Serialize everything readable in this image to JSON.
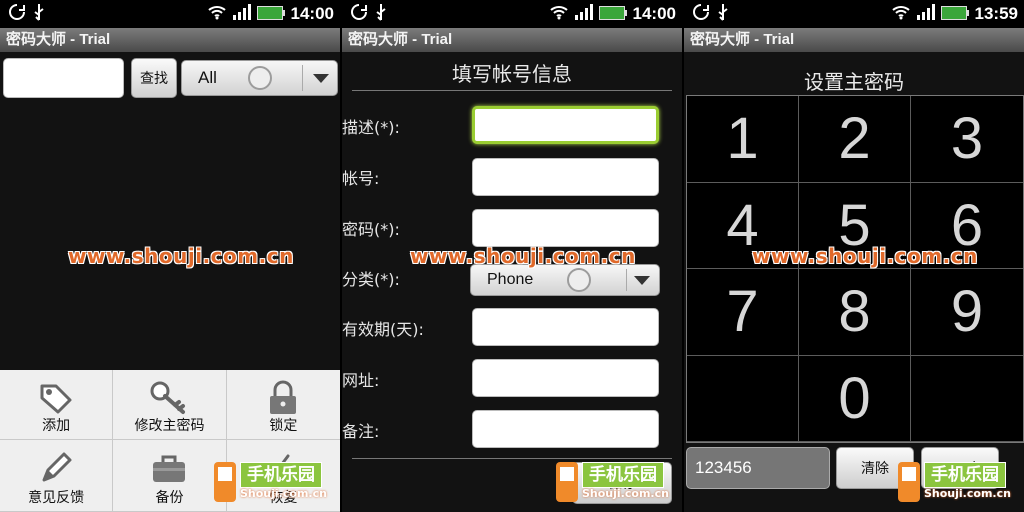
{
  "status": {
    "panel1_time": "14:00",
    "panel2_time": "14:00",
    "panel3_time": "13:59"
  },
  "app_title": "密码大师 - Trial",
  "list_screen": {
    "search_button": "查找",
    "category_value": "All",
    "menu": [
      {
        "label": "添加",
        "icon": "tag-icon"
      },
      {
        "label": "修改主密码",
        "icon": "key-icon"
      },
      {
        "label": "锁定",
        "icon": "lock-icon"
      },
      {
        "label": "意见反馈",
        "icon": "pencil-icon"
      },
      {
        "label": "备份",
        "icon": "toolbox-icon"
      },
      {
        "label": "恢复",
        "icon": "paperclip-icon"
      }
    ]
  },
  "form_screen": {
    "title": "填写帐号信息",
    "fields": [
      {
        "label": "描述(*):"
      },
      {
        "label": "帐号:"
      },
      {
        "label": "密码(*):"
      },
      {
        "label": "分类(*):",
        "value": "Phone"
      },
      {
        "label": "有效期(天):"
      },
      {
        "label": "网址:"
      },
      {
        "label": "备注:"
      }
    ],
    "save_button": "保存"
  },
  "pin_screen": {
    "title": "设置主密码",
    "keys": [
      "1",
      "2",
      "3",
      "4",
      "5",
      "6",
      "7",
      "8",
      "9",
      "",
      "0",
      ""
    ],
    "pin_value": "123456",
    "clear_button": "清除",
    "next_button": "下一步"
  },
  "overlay": {
    "watermark": "www.shouji.com.cn",
    "logo_brand": "手机乐园",
    "logo_url": "Shouji.com.cn"
  },
  "colors": {
    "accent_focus": "#9acd32",
    "watermark": "#e0692a",
    "logo_green": "#8bc53f"
  }
}
